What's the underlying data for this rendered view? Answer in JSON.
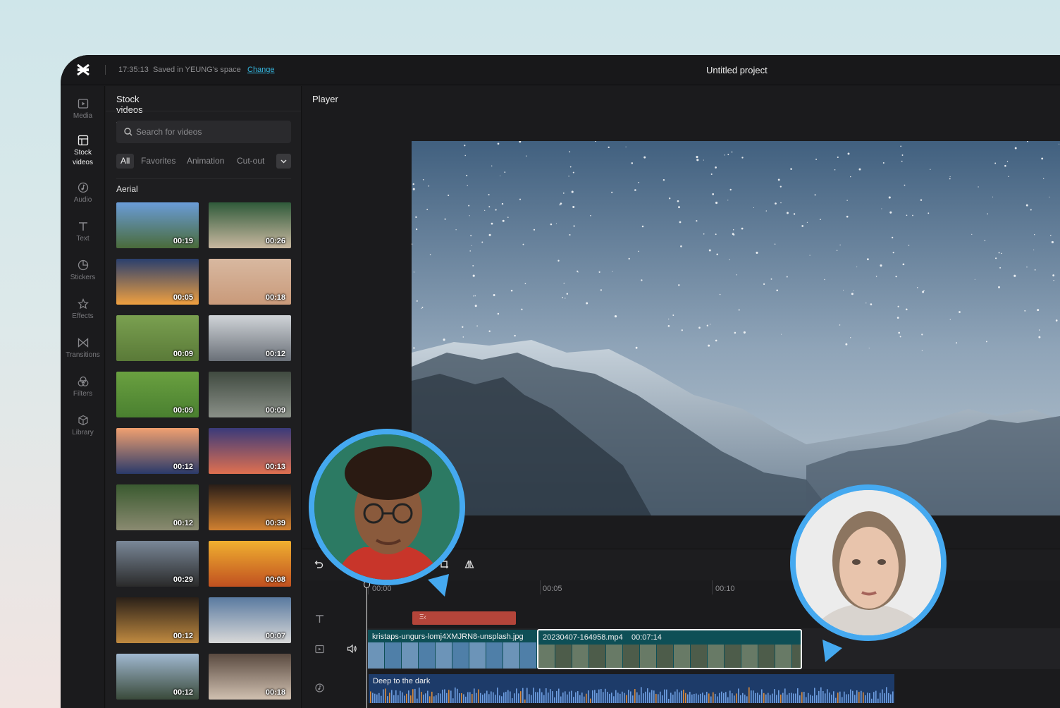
{
  "topbar": {
    "save_time": "17:35:13",
    "save_text": "Saved in YEUNG's space",
    "change_label": "Change",
    "project_title": "Untitled project"
  },
  "rail": [
    {
      "label": "Media",
      "icon": "media-icon"
    },
    {
      "label": "Stock videos",
      "icon": "stock-videos-icon",
      "active": true
    },
    {
      "label": "Audio",
      "icon": "audio-icon"
    },
    {
      "label": "Text",
      "icon": "text-icon"
    },
    {
      "label": "Stickers",
      "icon": "stickers-icon"
    },
    {
      "label": "Effects",
      "icon": "effects-icon"
    },
    {
      "label": "Transitions",
      "icon": "transitions-icon"
    },
    {
      "label": "Filters",
      "icon": "filters-icon"
    },
    {
      "label": "Library",
      "icon": "library-icon"
    }
  ],
  "panel": {
    "tab": "Stock videos",
    "search_placeholder": "Search for videos",
    "filters": [
      "All",
      "Favorites",
      "Animation",
      "Cut-out"
    ],
    "active_filter": "All",
    "section": "Aerial",
    "thumbs": [
      {
        "duration": "00:19"
      },
      {
        "duration": "00:26"
      },
      {
        "duration": "00:05"
      },
      {
        "duration": "00:18"
      },
      {
        "duration": "00:09"
      },
      {
        "duration": "00:12"
      },
      {
        "duration": "00:09"
      },
      {
        "duration": "00:09"
      },
      {
        "duration": "00:12"
      },
      {
        "duration": "00:13"
      },
      {
        "duration": "00:12"
      },
      {
        "duration": "00:39"
      },
      {
        "duration": "00:29"
      },
      {
        "duration": "00:08"
      },
      {
        "duration": "00:12"
      },
      {
        "duration": "00:07"
      },
      {
        "duration": "00:12"
      },
      {
        "duration": "00:18"
      }
    ]
  },
  "player": {
    "title": "Player"
  },
  "timeline": {
    "ruler": [
      "00:00",
      "00:05",
      "00:10"
    ],
    "text_clip_label": "Ξ‹",
    "clip1_name": "kristaps-ungurs-lomj4XMJRN8-unsplash.jpg",
    "clip2_name": "20230407-164958.mp4",
    "clip2_duration": "00:07:14",
    "audio_name": "Deep to the dark"
  },
  "colors": {
    "accent": "#35b7e0",
    "avatar_ring": "#45a9f0",
    "text_clip": "#b4453a",
    "video_clip": "#0e4f56",
    "audio_clip": "#1d3b69"
  }
}
